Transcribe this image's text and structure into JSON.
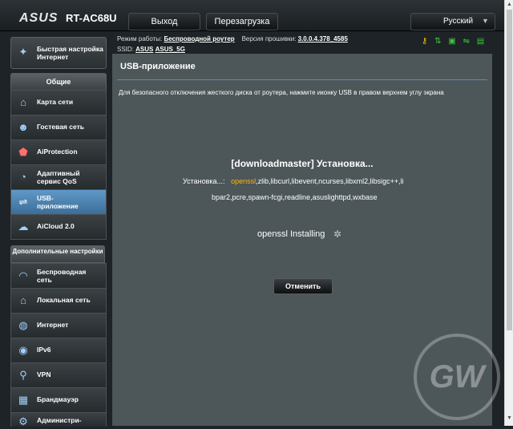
{
  "header": {
    "logo": "ASUS",
    "model": "RT-AC68U",
    "logout_label": "Выход",
    "reboot_label": "Перезагрузка",
    "language": "Русский"
  },
  "status": {
    "mode_label": "Режим работы:",
    "mode_value": "Беспроводной роутер",
    "firmware_label": "Версия прошивки:",
    "firmware_value": "3.0.0.4.378_4585",
    "ssid_label": "SSID:",
    "ssid_24": "ASUS",
    "ssid_5": "ASUS_5G"
  },
  "sidebar": {
    "quick_setup": "Быстрая настройка Интернет",
    "general_header": "Общие",
    "general_items": [
      {
        "label": "Карта сети",
        "icon": "network-map-icon"
      },
      {
        "label": "Гостевая сеть",
        "icon": "guest-network-icon"
      },
      {
        "label": "AiProtection",
        "icon": "aiprotection-icon"
      },
      {
        "label": "Адаптивный сервис QoS",
        "icon": "qos-icon"
      },
      {
        "label": "USB-приложение",
        "icon": "usb-icon"
      },
      {
        "label": "AiCloud 2.0",
        "icon": "cloud-icon"
      }
    ],
    "advanced_header": "Дополнительные настройки",
    "advanced_items": [
      {
        "label": "Беспроводная сеть",
        "icon": "wireless-icon"
      },
      {
        "label": "Локальная сеть",
        "icon": "lan-icon"
      },
      {
        "label": "Интернет",
        "icon": "globe-icon"
      },
      {
        "label": "IPv6",
        "icon": "ipv6-icon"
      },
      {
        "label": "VPN",
        "icon": "vpn-icon"
      },
      {
        "label": "Брандмауэр",
        "icon": "firewall-icon"
      },
      {
        "label": "Администри-",
        "icon": "admin-icon"
      }
    ]
  },
  "main": {
    "title": "USB-приложение",
    "description": "Для безопасного отключения жесткого диска от роутера, нажмите иконку USB в правом верхнем углу экрана",
    "install_title": "[downloadmaster] Установка...",
    "installing_prefix": "Установка...:",
    "current_package": "openssl",
    "deps_line1": ",zlib,libcurl,libevent,ncurses,libxml2,libsigc++,li",
    "deps_line2": "bpar2,pcre,spawn-fcgi,readline,asuslighttpd,wxbase",
    "installing_status": "openssl Installing",
    "cancel_label": "Отменить"
  },
  "colors": {
    "accent": "#ffb800",
    "active_item": "#5f99c8",
    "panel": "#4d5659"
  }
}
